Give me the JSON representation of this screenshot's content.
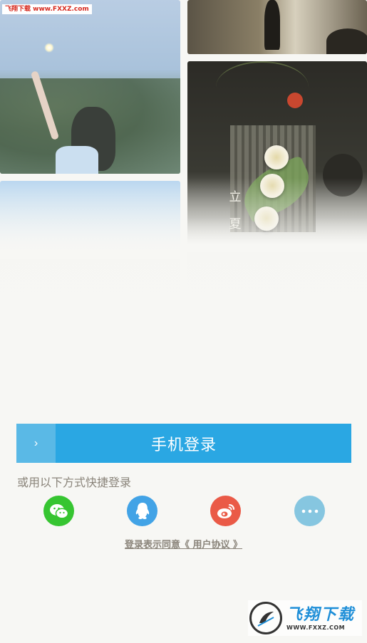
{
  "watermark_top": "飞翔下载 www.FXXZ.com",
  "photos": {
    "tea_vertical_text": [
      "立",
      "夏"
    ]
  },
  "login": {
    "arrow": "›",
    "label": "手机登录"
  },
  "quick_login_text": "或用以下方式快捷登录",
  "social": [
    {
      "name": "wechat",
      "icon": "wechat-icon",
      "color": "#36c531"
    },
    {
      "name": "qq",
      "icon": "qq-icon",
      "color": "#42a3e6"
    },
    {
      "name": "weibo",
      "icon": "weibo-icon",
      "color": "#ea5a47"
    },
    {
      "name": "more",
      "icon": "more-dots-icon",
      "color": "#86c6e0"
    }
  ],
  "agreement_text": "登录表示同意《 用户协议 》",
  "watermark_bottom": {
    "cn": "飞翔下载",
    "url": "WWW.FXXZ.COM"
  }
}
